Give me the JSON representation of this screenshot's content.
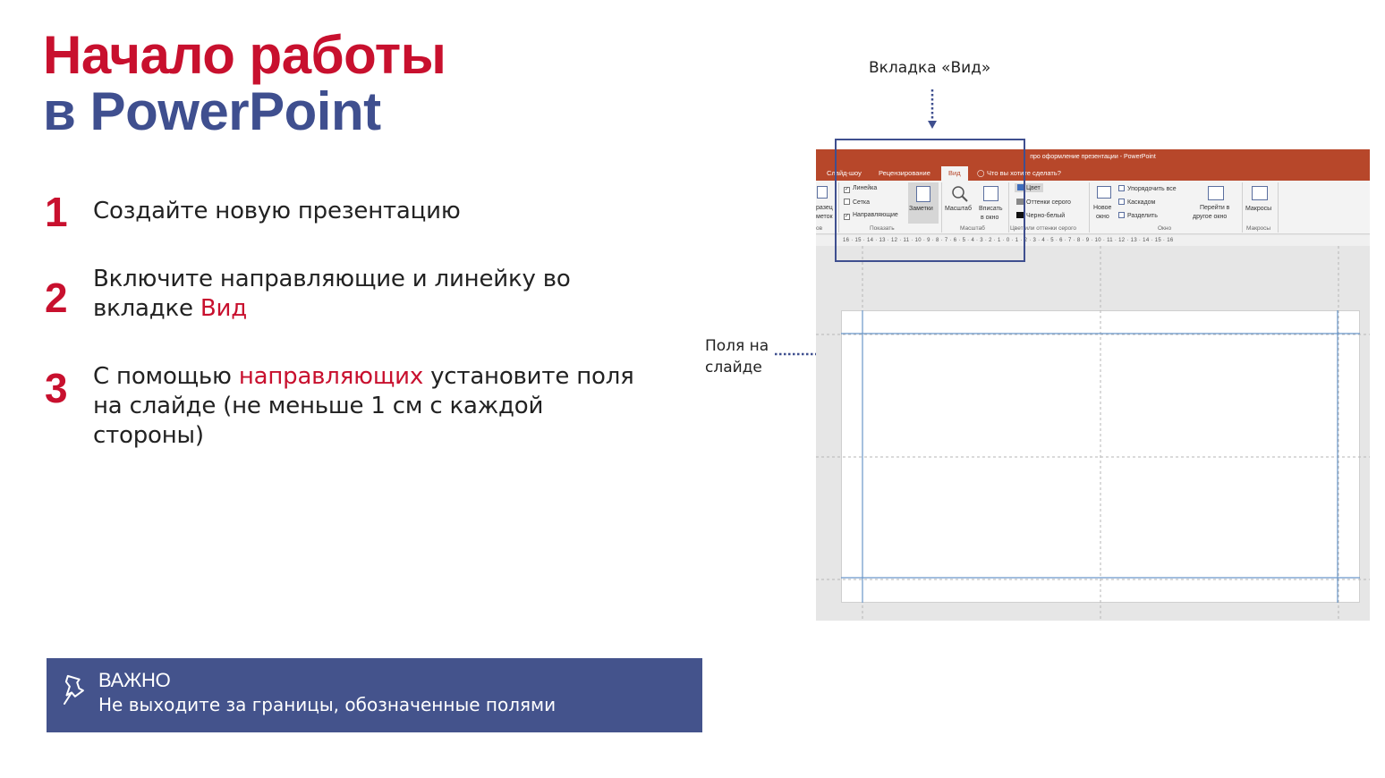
{
  "title": {
    "line1": "Начало работы",
    "line2": "в PowerPoint"
  },
  "steps": [
    {
      "num": "1",
      "text": "Создайте новую презентацию"
    },
    {
      "num": "2",
      "text_before": "Включите направляющие и линейку во вкладке ",
      "highlight": "Вид",
      "text_after": ""
    },
    {
      "num": "3",
      "text_before": "С помощью ",
      "highlight": "направляющих",
      "text_after": " установите поля на слайде (не меньше 1 см с каждой стороны)"
    }
  ],
  "important": {
    "heading": "ВАЖНО",
    "body": "Не выходите за границы, обозначенные полями",
    "icon": "pin-icon"
  },
  "callouts": {
    "view_tab": "Вкладка «Вид»",
    "margins": "Поля на слайде"
  },
  "screenshot": {
    "window_title": "про оформление презентации - PowerPoint",
    "tabs": [
      "Слайд-шоу",
      "Рецензирование",
      "Вид",
      "Что вы хотите сделать?"
    ],
    "show_group": {
      "ruler": "Линейка",
      "grid": "Сетка",
      "guides": "Направляющие",
      "notes": "Заметки",
      "label": "Показать"
    },
    "zoom_group": {
      "zoom": "Масштаб",
      "fit": "Вписать",
      "fit2": "в окно",
      "label": "Масштаб"
    },
    "color_group": {
      "color": "Цвет",
      "gray": "Оттенки серого",
      "bw": "Черно-белый",
      "label": "Цвет или оттенки серого"
    },
    "window_group": {
      "new1": "Новое",
      "new2": "окно",
      "arrange": "Упорядочить все",
      "cascade": "Каскадом",
      "split": "Разделить",
      "switch1": "Перейти в",
      "switch2": "другое окно",
      "label": "Окно"
    },
    "macros_group": {
      "macros": "Макросы",
      "label": "Макросы"
    },
    "left_cut": {
      "a": "разец",
      "b": "меток",
      "c": "ов"
    },
    "ruler_text": "16 · 15 · 14 · 13 · 12 · 11 · 10 · 9 · 8 · 7 · 6 · 5 · 4 · 3 · 2 · 1 · 0 · 1 · 2 · 3 · 4 · 5 · 6 · 7 · 8 · 9 · 10 · 11 · 12 · 13 · 14 · 15 · 16"
  },
  "colors": {
    "red": "#c8102e",
    "navy": "#3f4f8f",
    "ppt_orange": "#b7472a",
    "guide_blue": "#5b8fc7"
  }
}
